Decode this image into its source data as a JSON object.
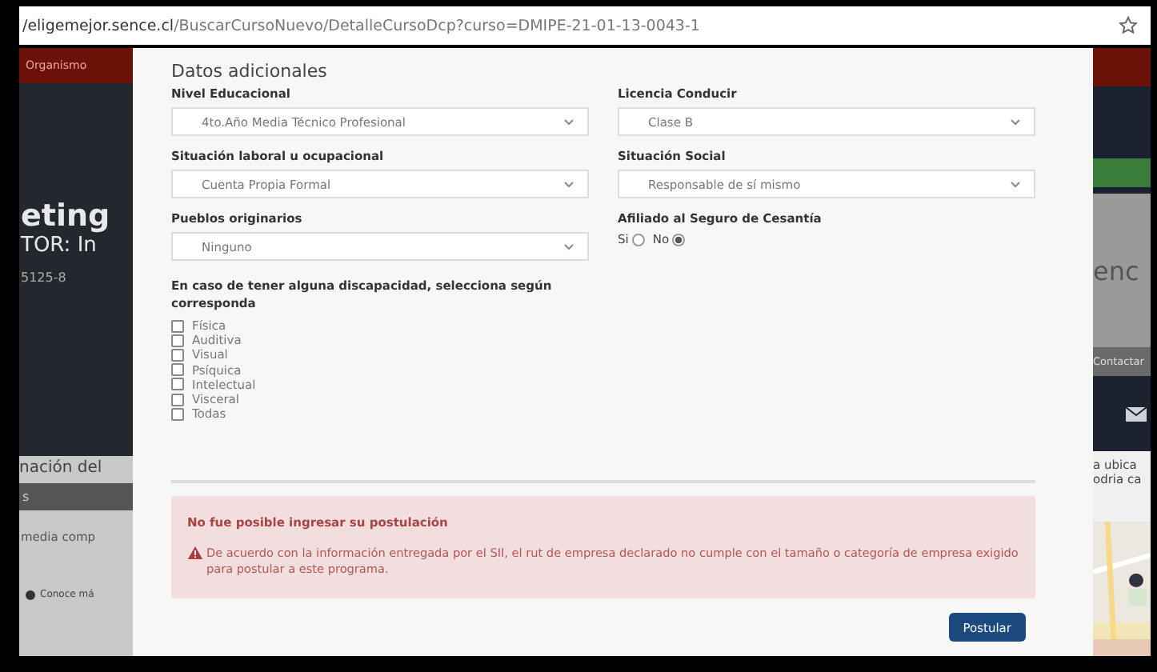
{
  "browser": {
    "url_host": "/eligemejor.sence.cl",
    "url_path": "/BuscarCursoNuevo/DetalleCursoDcp?curso=DMIPE-21-01-13-0043-1"
  },
  "background_left": {
    "nav_link": "Organismo",
    "title": "eting",
    "subtitle": "TOR: In",
    "code": "5125-8",
    "section_heading": "nación del",
    "tab": "s",
    "text": "media comp",
    "link": "Conoce má"
  },
  "background_right": {
    "logo": "enc",
    "nav_link": "Contactar",
    "text_1": "a ubica",
    "text_2": "odria ca"
  },
  "modal": {
    "heading": "Datos adicionales",
    "fields": [
      {
        "kind": "select",
        "label": "Nivel Educacional",
        "value": "4to.Año Media Técnico Profesional"
      },
      {
        "kind": "select",
        "label": "Licencia Conducir",
        "value": "Clase B"
      },
      {
        "kind": "select",
        "label": "Situación laboral u ocupacional",
        "value": "Cuenta Propia Formal"
      },
      {
        "kind": "select",
        "label": "Situación Social",
        "value": "Responsable de sí mismo"
      },
      {
        "kind": "select",
        "label": "Pueblos originarios",
        "value": "Ninguno"
      },
      {
        "kind": "radio",
        "label": "Afiliado al Seguro de Cesantía",
        "options": [
          {
            "label": "Si",
            "selected": false
          },
          {
            "label": "No",
            "selected": true
          }
        ]
      }
    ],
    "disability": {
      "label": "En caso de tener alguna discapacidad, selecciona según corresponda",
      "options": [
        {
          "label": "Física",
          "checked": false
        },
        {
          "label": "Auditiva",
          "checked": false
        },
        {
          "label": "Visual",
          "checked": false
        },
        {
          "label": "Psíquica",
          "checked": false
        },
        {
          "label": "Intelectual",
          "checked": false
        },
        {
          "label": "Visceral",
          "checked": false
        },
        {
          "label": "Todas",
          "checked": false
        }
      ]
    },
    "alert": {
      "title": "No fue posible ingresar su postulación",
      "message": "De acuerdo con la información entregada por el SII, el rut de empresa declarado no cumple con el tamaño o categoría de empresa exigido para postular a este programa."
    },
    "submit": "Postular"
  }
}
